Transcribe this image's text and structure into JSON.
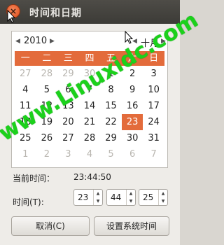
{
  "window": {
    "title": "时间和日期",
    "close_glyph": "×"
  },
  "calendar": {
    "year": "2010",
    "month": "十月",
    "prev_glyph": "◀",
    "next_glyph": "▶",
    "weekdays": [
      "一",
      "二",
      "三",
      "四",
      "五",
      "六",
      "日"
    ],
    "weeks": [
      [
        {
          "d": "27",
          "o": true
        },
        {
          "d": "28",
          "o": true
        },
        {
          "d": "29",
          "o": true
        },
        {
          "d": "30",
          "o": true
        },
        {
          "d": "1"
        },
        {
          "d": "2"
        },
        {
          "d": "3"
        }
      ],
      [
        {
          "d": "4"
        },
        {
          "d": "5"
        },
        {
          "d": "6"
        },
        {
          "d": "7"
        },
        {
          "d": "8"
        },
        {
          "d": "9"
        },
        {
          "d": "10"
        }
      ],
      [
        {
          "d": "11"
        },
        {
          "d": "12"
        },
        {
          "d": "13"
        },
        {
          "d": "14"
        },
        {
          "d": "15"
        },
        {
          "d": "16"
        },
        {
          "d": "17"
        }
      ],
      [
        {
          "d": "18"
        },
        {
          "d": "19"
        },
        {
          "d": "20"
        },
        {
          "d": "21"
        },
        {
          "d": "22"
        },
        {
          "d": "23",
          "s": true
        },
        {
          "d": "24"
        }
      ],
      [
        {
          "d": "25"
        },
        {
          "d": "26"
        },
        {
          "d": "27"
        },
        {
          "d": "28"
        },
        {
          "d": "29"
        },
        {
          "d": "30"
        },
        {
          "d": "31"
        }
      ],
      [
        {
          "d": "1",
          "o": true
        },
        {
          "d": "2",
          "o": true
        },
        {
          "d": "3",
          "o": true
        },
        {
          "d": "4",
          "o": true
        },
        {
          "d": "5",
          "o": true
        },
        {
          "d": "6",
          "o": true
        },
        {
          "d": "7",
          "o": true
        }
      ]
    ]
  },
  "current_time": {
    "label": "当前时间：",
    "value": "23:44:50"
  },
  "set_time": {
    "label": "时间(T):",
    "hour": "23",
    "minute": "44",
    "second": "25"
  },
  "buttons": {
    "cancel": "取消(C)",
    "set_system_time": "设置系统时间"
  },
  "watermark": "www.Linuxidc.com",
  "colors": {
    "accent": "#e36b3b",
    "watermark": "#1bd11b"
  }
}
